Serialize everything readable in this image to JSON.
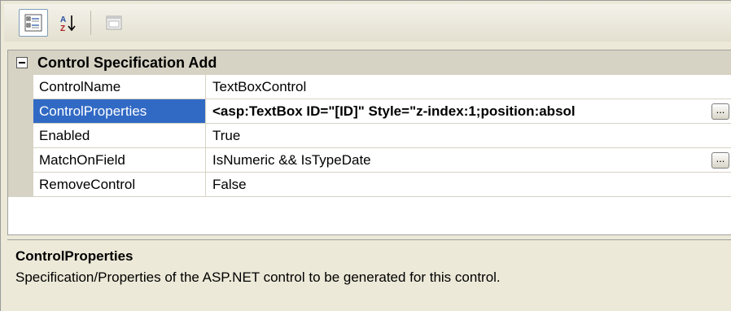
{
  "toolbar": {
    "buttons": [
      {
        "icon": "categorized-icon",
        "active": true
      },
      {
        "icon": "alphabetical-sort-icon",
        "active": false
      },
      {
        "icon": "property-pages-icon",
        "active": false
      }
    ]
  },
  "category": {
    "label": "Control Specification Add",
    "expanded": true
  },
  "properties": [
    {
      "name": "ControlName",
      "value": "TextBoxControl",
      "selected": false,
      "has_ellipsis": false
    },
    {
      "name": "ControlProperties",
      "value": "<asp:TextBox ID=\"[ID]\" Style=\"z-index:1;position:absol",
      "selected": true,
      "has_ellipsis": true
    },
    {
      "name": "Enabled",
      "value": "True",
      "selected": false,
      "has_ellipsis": false
    },
    {
      "name": "MatchOnField",
      "value": "IsNumeric && IsTypeDate",
      "selected": false,
      "has_ellipsis": true
    },
    {
      "name": "RemoveControl",
      "value": "False",
      "selected": false,
      "has_ellipsis": false
    }
  ],
  "ellipsis_label": "...",
  "description": {
    "title": "ControlProperties",
    "text": "Specification/Properties of the ASP.NET control to be generated for this control."
  },
  "colors": {
    "selection": "#316ac5",
    "gutter": "#d6d3c4",
    "panel": "#ece9d8"
  }
}
